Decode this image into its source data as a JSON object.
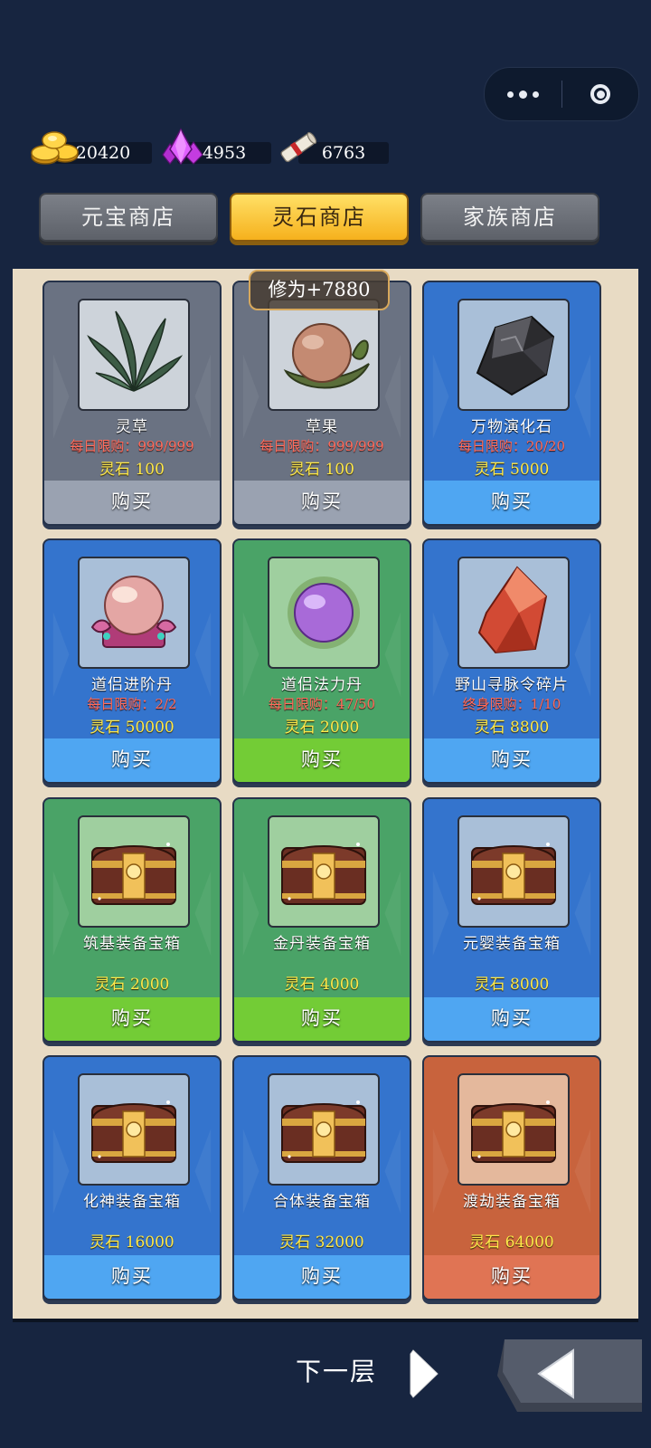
{
  "capsule": {
    "more_icon": "more-dots-icon",
    "close_icon": "target-close-icon"
  },
  "currencies": [
    {
      "name": "gold-coins",
      "value": "20420"
    },
    {
      "name": "purple-gems",
      "value": "4953"
    },
    {
      "name": "scroll",
      "value": "6763"
    }
  ],
  "tabs": [
    {
      "label": "元宝商店",
      "active": false
    },
    {
      "label": "灵石商店",
      "active": true
    },
    {
      "label": "家族商店",
      "active": false
    }
  ],
  "badge": "修为+7880",
  "items": [
    {
      "name": "灵草",
      "limit": "每日限购：999/999",
      "price": "灵石 100",
      "buy": "购买",
      "color": "gray",
      "icon": "grass-icon"
    },
    {
      "name": "草果",
      "limit": "每日限购：999/999",
      "price": "灵石 100",
      "buy": "购买",
      "color": "gray",
      "icon": "fruit-icon"
    },
    {
      "name": "万物演化石",
      "limit": "每日限购：20/20",
      "price": "灵石 5000",
      "buy": "购买",
      "color": "blue",
      "icon": "black-stone-icon"
    },
    {
      "name": "道侣进阶丹",
      "limit": "每日限购：2/2",
      "price": "灵石 50000",
      "buy": "购买",
      "color": "blue",
      "icon": "crystal-orb-icon"
    },
    {
      "name": "道侣法力丹",
      "limit": "每日限购：47/50",
      "price": "灵石 2000",
      "buy": "购买",
      "color": "green",
      "icon": "purple-orb-icon"
    },
    {
      "name": "野山寻脉令碎片",
      "limit": "终身限购：1/10",
      "price": "灵石 8800",
      "buy": "购买",
      "color": "blue",
      "icon": "red-crystal-icon"
    },
    {
      "name": "筑基装备宝箱",
      "limit": "",
      "price": "灵石 2000",
      "buy": "购买",
      "color": "green",
      "icon": "treasure-chest-icon"
    },
    {
      "name": "金丹装备宝箱",
      "limit": "",
      "price": "灵石 4000",
      "buy": "购买",
      "color": "green",
      "icon": "treasure-chest-icon"
    },
    {
      "name": "元婴装备宝箱",
      "limit": "",
      "price": "灵石 8000",
      "buy": "购买",
      "color": "blue",
      "icon": "treasure-chest-icon"
    },
    {
      "name": "化神装备宝箱",
      "limit": "",
      "price": "灵石 16000",
      "buy": "购买",
      "color": "blue",
      "icon": "treasure-chest-icon"
    },
    {
      "name": "合体装备宝箱",
      "limit": "",
      "price": "灵石 32000",
      "buy": "购买",
      "color": "blue",
      "icon": "treasure-chest-icon"
    },
    {
      "name": "渡劫装备宝箱",
      "limit": "",
      "price": "灵石 64000",
      "buy": "购买",
      "color": "orange",
      "icon": "treasure-chest-icon"
    }
  ],
  "footer": {
    "next_label": "下一层",
    "next_icon": "chevron-right-icon",
    "back_icon": "back-arrow-icon"
  }
}
